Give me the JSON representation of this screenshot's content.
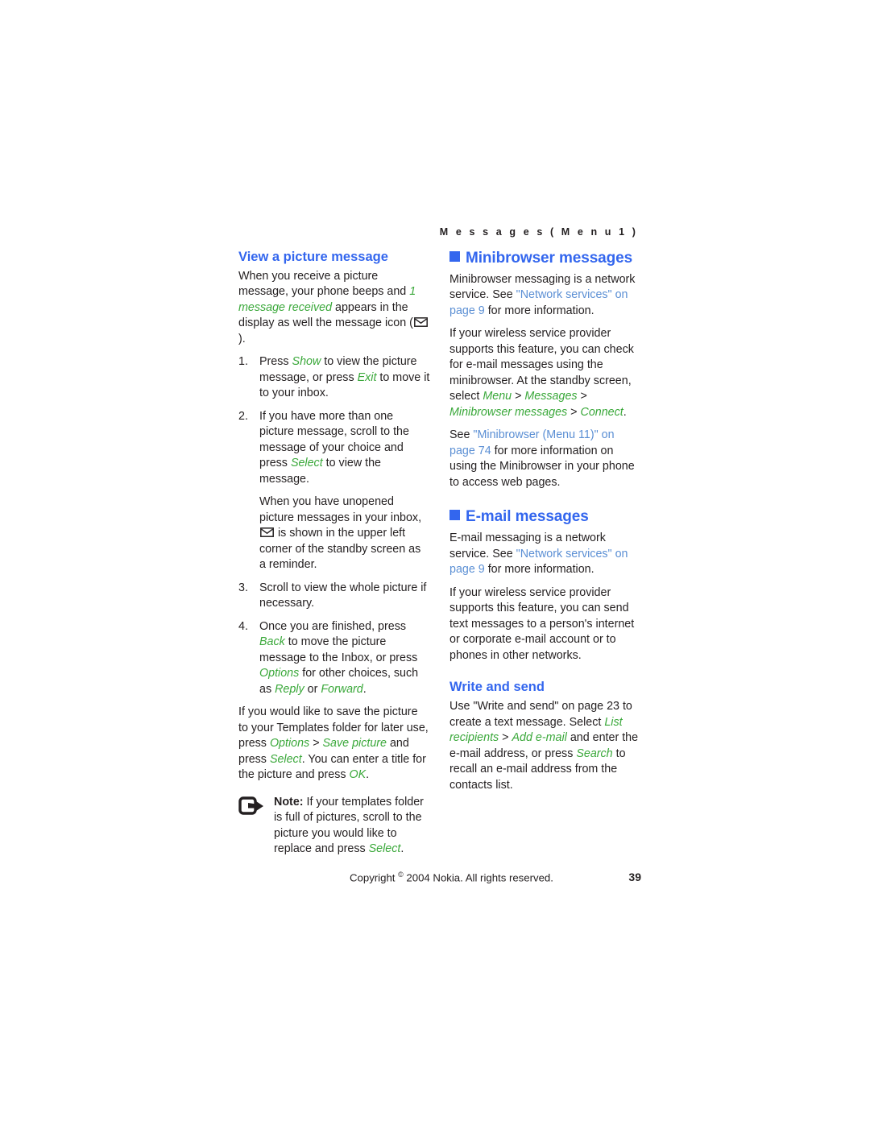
{
  "running_header": "M e s s a g e s   ( M e n u   1 )",
  "colors": {
    "heading_blue": "#3366ee",
    "link_blue": "#5b8fd4",
    "command_green": "#3aa83a",
    "body_text": "#231f20"
  },
  "left_column": {
    "heading": "View a picture message",
    "intro": {
      "part1": "When you receive a picture message, your phone beeps and ",
      "cmd1": "1 message received",
      "part2": " appears in the display as well the message icon (",
      "icon": "envelope-icon",
      "part3": ")."
    },
    "steps": [
      {
        "num": "1.",
        "part1": "Press ",
        "cmd1": "Show",
        "part2": " to view the picture message, or press ",
        "cmd2": "Exit",
        "part3": " to move it to your inbox."
      },
      {
        "num": "2.",
        "part1": "If you have more than one picture message, scroll to the message of your choice and press ",
        "cmd1": "Select",
        "part2": " to view the message.",
        "sub_part1": "When you have unopened picture messages in your inbox, ",
        "sub_icon": "envelope-icon",
        "sub_part2": " is shown in the upper left corner of the standby screen as a reminder."
      },
      {
        "num": "3.",
        "part1": "Scroll to view the whole picture if necessary."
      },
      {
        "num": "4.",
        "part1": "Once you are finished, press ",
        "cmd1": "Back",
        "part2": " to move the picture message to the Inbox, or press ",
        "cmd2": "Options",
        "part3": " for other choices, such as ",
        "cmd3": "Reply",
        "part4": " or ",
        "cmd4": "Forward",
        "part5": "."
      }
    ],
    "save_para": {
      "part1": "If you would like to save the picture to your Templates folder for later use, press ",
      "cmd1": "Options",
      "part2": " > ",
      "cmd2": "Save picture",
      "part3": " and press ",
      "cmd3": "Select",
      "part4": ". You can enter a title for the picture and press ",
      "cmd4": "OK",
      "part5": "."
    },
    "note": {
      "icon": "note-arrow-icon",
      "label": "Note:",
      "part1": " If your templates folder is full of pictures, scroll to the picture you would like to replace and press ",
      "cmd1": "Select",
      "part2": "."
    }
  },
  "right_column": {
    "minibrowser": {
      "heading": "Minibrowser messages",
      "bullet": "square-bullet-icon",
      "para1": {
        "part1": "Minibrowser messaging is a network service. See ",
        "link1": "\"Network services\" on page 9",
        "part2": " for more information."
      },
      "para2": {
        "part1": "If your wireless service provider supports this feature, you can check for e-mail messages using the minibrowser. At the standby screen, select ",
        "cmd1": "Menu",
        "part2": " > ",
        "cmd2": "Messages",
        "part3": " > ",
        "cmd3": "Minibrowser messages",
        "part4": " > ",
        "cmd4": "Connect",
        "part5": "."
      },
      "para3": {
        "part1": "See ",
        "link1": "\"Minibrowser (Menu 11)\" on page 74",
        "part2": " for more information on using the Minibrowser in your phone to access web pages."
      }
    },
    "email": {
      "heading": "E-mail messages",
      "bullet": "square-bullet-icon",
      "para1": {
        "part1": "E-mail messaging is a network service. See ",
        "link1": "\"Network services\" on page 9",
        "part2": " for more information."
      },
      "para2": {
        "part1": "If your wireless service provider supports this feature, you can send text messages to a person's internet or corporate e-mail account or to phones in other networks."
      }
    },
    "write_and_send": {
      "heading": "Write and send",
      "para1": {
        "part1": "Use \"Write and send\" on page 23 to create a text message. Select ",
        "cmd1": "List recipients",
        "part2": " > ",
        "cmd2": "Add e-mail",
        "part3": " and enter the e-mail address, or press ",
        "cmd3": "Search",
        "part4": " to recall an e-mail address from the contacts list."
      }
    }
  },
  "footer": {
    "copyright_pre": "Copyright ",
    "copyright_mark": "©",
    "copyright_post": " 2004 Nokia. All rights reserved.",
    "page_number": "39"
  }
}
